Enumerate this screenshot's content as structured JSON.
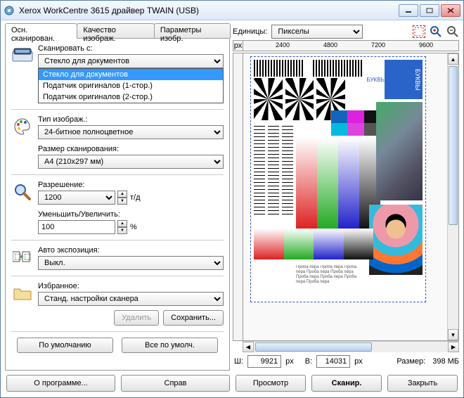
{
  "window": {
    "title": "Xerox WorkCentre 3615 драйвер TWAIN (USB)"
  },
  "tabs": {
    "main": "Осн. сканирован.",
    "quality": "Качество изображ.",
    "params": "Параметры изобр."
  },
  "scanFrom": {
    "label": "Сканировать с:",
    "selected": "Стекло для документов",
    "options": {
      "glass": "Стекло для документов",
      "feeder1": "Податчик оригиналов (1-стор.)",
      "feeder2": "Податчик оригиналов (2-стор.)"
    }
  },
  "imageType": {
    "label": "Тип изображ.:",
    "selected": "24-битное полноцветное"
  },
  "scanSize": {
    "label": "Размер сканирования:",
    "selected": "A4 (210x297 мм)"
  },
  "resolution": {
    "label": "Разрешение:",
    "value": "1200",
    "unit": "т/д"
  },
  "zoom": {
    "label": "Уменьшить/Увеличить:",
    "value": "100",
    "unit": "%"
  },
  "autoExposure": {
    "label": "Авто экспозиция:",
    "selected": "Выкл."
  },
  "favorites": {
    "label": "Избранное:",
    "selected": "Станд. настройки сканера",
    "deleteBtn": "Удалить",
    "saveBtn": "Сохранить..."
  },
  "bottomLeftButtons": {
    "default": "По умолчанию",
    "allDefault": "Все по умолч."
  },
  "units": {
    "label": "Единицы:",
    "selected": "Пикселы"
  },
  "ruler": {
    "corner": "px",
    "t1": "2400",
    "t2": "4800",
    "t3": "7200",
    "t4": "9600"
  },
  "status": {
    "wLabel": "Ш:",
    "wValue": "9921",
    "hLabel": "В:",
    "hValue": "14031",
    "pxUnit": "px",
    "sizeLabel": "Размер:",
    "sizeValue": "398 МБ"
  },
  "footer": {
    "about": "О программе...",
    "help": "Справ",
    "preview": "Просмотр",
    "scan": "Сканир.",
    "close": "Закрыть"
  },
  "previewText": {
    "bukvy": "БУКВЫ",
    "proba": "Проба пера Проба пера Проба пера Проба пера Проба пера Проба пера Проба пера Проба пера Проба пера"
  }
}
